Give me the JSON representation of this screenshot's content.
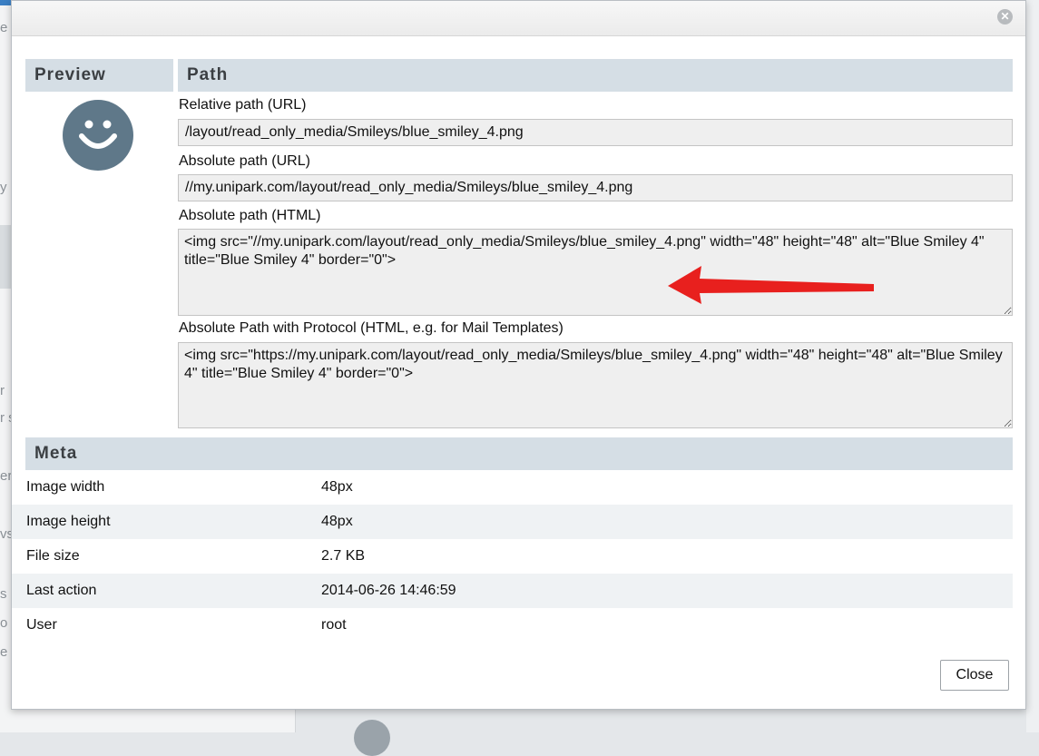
{
  "preview": {
    "heading": "Preview",
    "image_icon": "blue-smiley-icon"
  },
  "path": {
    "heading": "Path",
    "relative_url": {
      "label": "Relative path (URL)",
      "value": "/layout/read_only_media/Smileys/blue_smiley_4.png"
    },
    "absolute_url": {
      "label": "Absolute path (URL)",
      "value": "//my.unipark.com/layout/read_only_media/Smileys/blue_smiley_4.png"
    },
    "absolute_html": {
      "label": "Absolute path (HTML)",
      "value": "<img src=\"//my.unipark.com/layout/read_only_media/Smileys/blue_smiley_4.png\" width=\"48\" height=\"48\" alt=\"Blue Smiley 4\" title=\"Blue Smiley 4\" border=\"0\">"
    },
    "absolute_protocol": {
      "label": "Absolute Path with Protocol (HTML, e.g. for Mail Templates)",
      "value": "<img src=\"https://my.unipark.com/layout/read_only_media/Smileys/blue_smiley_4.png\" width=\"48\" height=\"48\" alt=\"Blue Smiley 4\" title=\"Blue Smiley 4\" border=\"0\">"
    }
  },
  "meta": {
    "heading": "Meta",
    "rows": [
      {
        "key": "Image width",
        "value": "48px"
      },
      {
        "key": "Image height",
        "value": "48px"
      },
      {
        "key": "File size",
        "value": "2.7 KB"
      },
      {
        "key": "Last action",
        "value": "2014-06-26 14:46:59"
      },
      {
        "key": "User",
        "value": "root"
      }
    ]
  },
  "buttons": {
    "close": "Close"
  },
  "background_fragments": [
    "e",
    "y",
    "r",
    "r s",
    "er",
    "vs",
    "s",
    "o",
    "e"
  ],
  "colors": {
    "header_bg": "#d5dee5",
    "avatar": "#5f7889",
    "arrow": "#e8201e",
    "input_bg": "#efefef"
  }
}
